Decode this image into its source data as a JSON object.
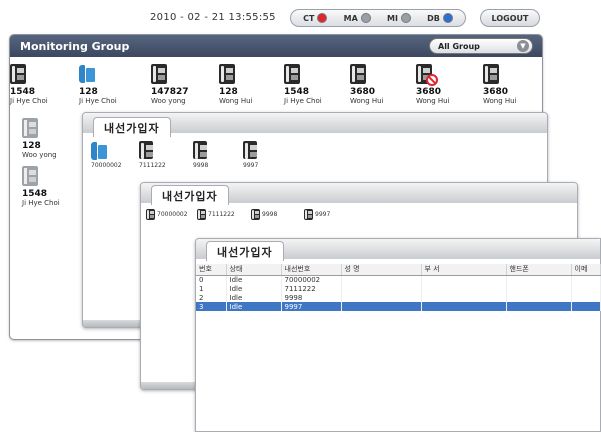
{
  "header": {
    "datetime": "2010 - 02 - 21 13:55:55",
    "statuses": [
      {
        "label": "CT",
        "color": "#e0262b"
      },
      {
        "label": "MA",
        "color": "#9aa0a6"
      },
      {
        "label": "MI",
        "color": "#9aa0a6"
      },
      {
        "label": "DB",
        "color": "#2c6fd1"
      }
    ],
    "logout": "LOGOUT"
  },
  "monitoring": {
    "title": "Monitoring Group",
    "group_select": "All Group",
    "phones": [
      {
        "number": "1548",
        "name": "Ji Hye Choi",
        "icon": "phone-idle-icon"
      },
      {
        "number": "128",
        "name": "Ji Hye Choi",
        "icon": "phone-offhook-icon"
      },
      {
        "number": "147827",
        "name": "Woo yong",
        "icon": "phone-idle-icon"
      },
      {
        "number": "128",
        "name": "Wong Hui",
        "icon": "phone-idle-icon"
      },
      {
        "number": "1548",
        "name": "Ji Hye Choi",
        "icon": "phone-idle-icon"
      },
      {
        "number": "3680",
        "name": "Wong Hui",
        "icon": "phone-idle-icon"
      },
      {
        "number": "3680",
        "name": "Wong Hui",
        "icon": "phone-blocked-icon"
      },
      {
        "number": "3680",
        "name": "Wong Hui",
        "icon": "phone-idle-icon"
      },
      {
        "number": "128",
        "name": "Woo yong",
        "icon": "phone-inactive-icon"
      },
      {
        "number": "1548",
        "name": "Ji Hye Choi",
        "icon": "phone-inactive-icon"
      }
    ]
  },
  "extension_windows": {
    "tab_label": "내선가입자",
    "icon_view": [
      "70000002",
      "7111222",
      "9998",
      "9997"
    ],
    "list_view": [
      "70000002",
      "7111222",
      "9998",
      "9997"
    ],
    "table": {
      "columns": [
        "번호",
        "상태",
        "내선번호",
        "성  명",
        "부  서",
        "핸드폰",
        "이메"
      ],
      "rows": [
        [
          "0",
          "Idle",
          "70000002"
        ],
        [
          "1",
          "Idle",
          "7111222"
        ],
        [
          "2",
          "Idle",
          "9998"
        ],
        [
          "3",
          "Idle",
          "9997"
        ]
      ],
      "selected_row": 3
    }
  }
}
